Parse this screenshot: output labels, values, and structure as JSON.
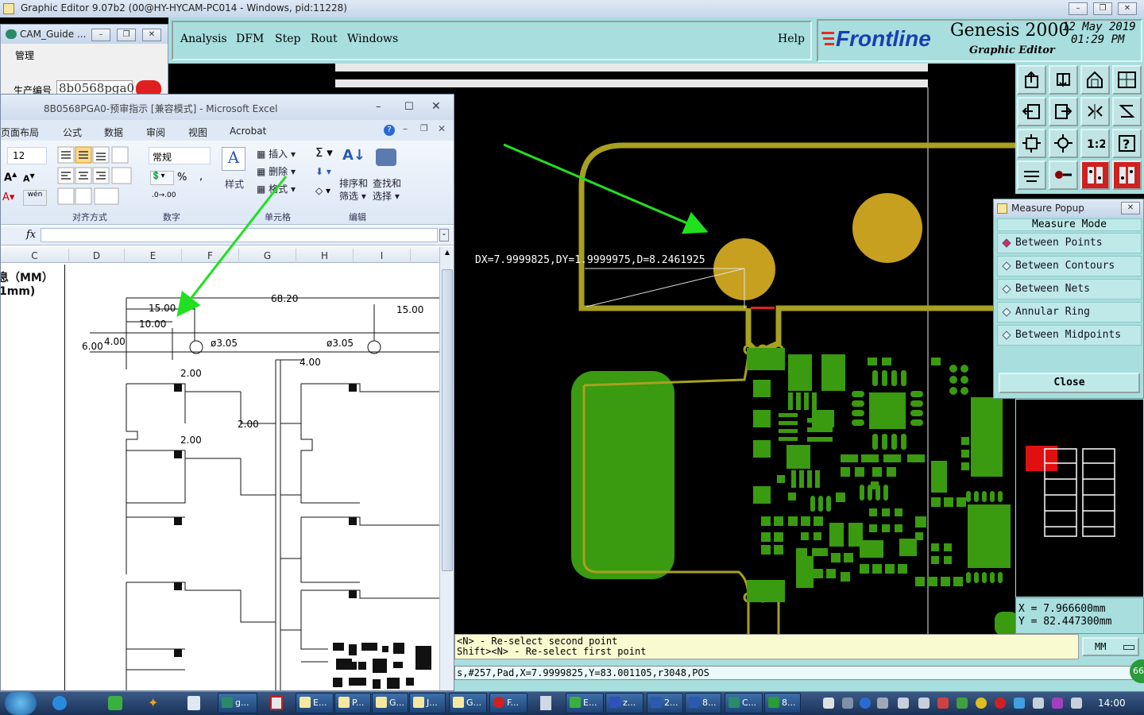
{
  "main_window": {
    "title": "Graphic Editor 9.07b2 (00@HY-HYCAM-PC014 - Windows, pid:11228)"
  },
  "genesis": {
    "menu": [
      "Analysis",
      "DFM",
      "Step",
      "Rout",
      "Windows"
    ],
    "help": "Help",
    "brand": "Frontline",
    "product": "Genesis 2000",
    "subtitle": "Graphic Editor",
    "date": "12 May 2019",
    "time": "01:29 PM",
    "measure_label": "DX=7.9999825,DY=1.9999975,D=8.2461925",
    "hint_line1": "<N> - Re-select second point",
    "hint_line2": "Shift><N> - Re-select first point",
    "status_line": "s,#257,Pad,X=7.9999825,Y=83.001105,r3048,POS",
    "coord_x": "X = 7.966600mm",
    "coord_y": "Y = 82.447300mm",
    "units": "MM"
  },
  "measure_popup": {
    "title": "Measure Popup",
    "heading": "Measure Mode",
    "items": [
      "Between Points",
      "Between Contours",
      "Between Nets",
      "Annular Ring",
      "Between Midpoints"
    ],
    "selected": 0,
    "close": "Close"
  },
  "cam_guide": {
    "title": "CAM_Guide ...",
    "menu": "管理",
    "field_label": "生产编号",
    "field_value": "8b0568pga0"
  },
  "excel": {
    "title": "8B0568PGA0-预审指示 [兼容模式] - Microsoft Excel",
    "tabs": [
      "页面布局",
      "公式",
      "数据",
      "审阅",
      "视图",
      "Acrobat"
    ],
    "font_size": "12",
    "number_format": "常规",
    "groups": {
      "align": "对齐方式",
      "number": "数字",
      "style": "样式",
      "cells": "单元格",
      "edit": "编辑"
    },
    "cells_buttons": [
      "插入",
      "删除",
      "格式"
    ],
    "edit_buttons": [
      "排序和",
      "筛选",
      "查找和",
      "选择"
    ],
    "fx": "fx",
    "columns": [
      "C",
      "D",
      "E",
      "F",
      "G",
      "H",
      "I"
    ],
    "cell_text1": "息（MM）",
    "cell_text2": "1mm)",
    "dims": {
      "d1": "15.00",
      "d2": "10.00",
      "d3": "68.20",
      "d4": "15.00",
      "d5": "6.00",
      "d6": "4.00",
      "d7": "ø3.05",
      "d8": "ø3.05",
      "d9": "4.00",
      "d10": "2.00",
      "d11": "2.00",
      "d12": "2.00"
    }
  },
  "taskbar": {
    "buttons": [
      "g...",
      "E...",
      "P...",
      "G...",
      "J...",
      "G...",
      "F...",
      "E...",
      "z...",
      "2...",
      "8...",
      "C...",
      "8..."
    ],
    "clock": "14:00"
  },
  "colors": {
    "copper": "#3a9a10",
    "trace": "#a8a020",
    "pad": "#c8a020",
    "arrow": "#20e020",
    "genesis_bg": "#a8dede"
  }
}
